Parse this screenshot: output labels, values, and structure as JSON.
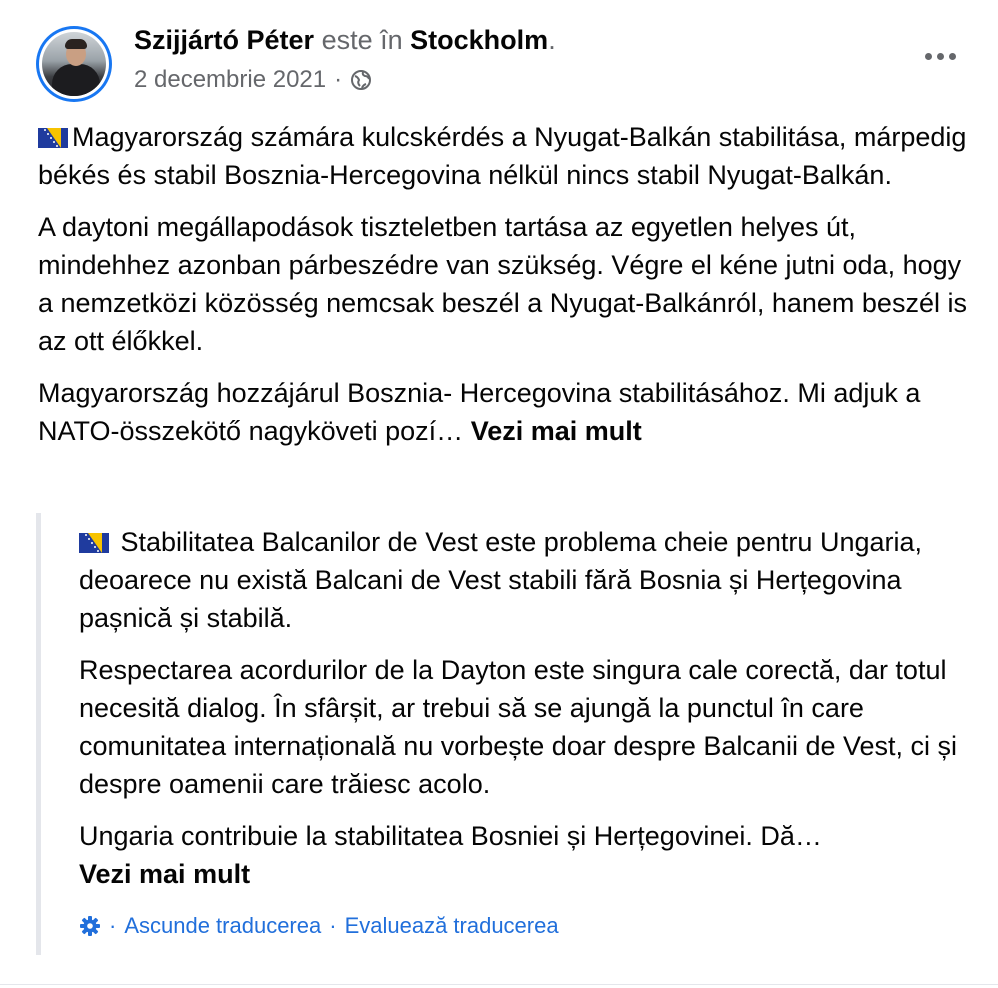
{
  "post": {
    "author": "Szijjártó Péter",
    "location_prefix": "este în",
    "location": "Stockholm",
    "location_suffix": ".",
    "date": "2 decembrie 2021",
    "date_separator": "·",
    "paragraphs": [
      "Magyarország számára  kulcskérdés a Nyugat-Balkán stabilitása, márpedig békés és stabil Bosznia-Hercegovina nélkül nincs stabil Nyugat-Balkán.",
      "A daytoni megállapodások tiszteletben tartása az egyetlen helyes út, mindehhez azonban párbeszédre van szükség. Végre el kéne jutni oda, hogy a nemzetközi közösség nemcsak beszél a Nyugat-Balkánról, hanem beszél is az ott élőkkel.",
      "Magyarország hozzájárul Bosznia- Hercegovina stabilitásához. Mi adjuk a NATO-összekötő nagyköveti pozí…"
    ],
    "see_more": "Vezi mai mult"
  },
  "translation": {
    "paragraphs": [
      "Stabilitatea Balcanilor de Vest este problema cheie pentru Ungaria, deoarece nu există Balcani de Vest stabili fără Bosnia și Herțegovina pașnică și stabilă.",
      "Respectarea acordurilor de la Dayton este singura cale corectă, dar totul necesită dialog. În sfârșit, ar trebui să se ajungă la punctul în care comunitatea internațională nu vorbește doar despre Balcanii de Vest, ci și despre oamenii care trăiesc acolo.",
      "Ungaria contribuie la stabilitatea Bosniei și Herțegovinei. Dă…"
    ],
    "see_more": "Vezi mai mult",
    "separator": "·",
    "hide_translation": "Ascunde traducerea",
    "rate_translation": "Evaluează traducerea"
  },
  "icons": {
    "avatar": "profile-photo",
    "privacy": "globe-icon",
    "more": "more-options-icon",
    "flag": "bosnia-flag-icon",
    "settings": "gear-icon"
  },
  "colors": {
    "link": "#216fdb",
    "muted": "#65676b",
    "avatar_ring": "#1877f2",
    "quote_bar": "#e4e6eb"
  }
}
